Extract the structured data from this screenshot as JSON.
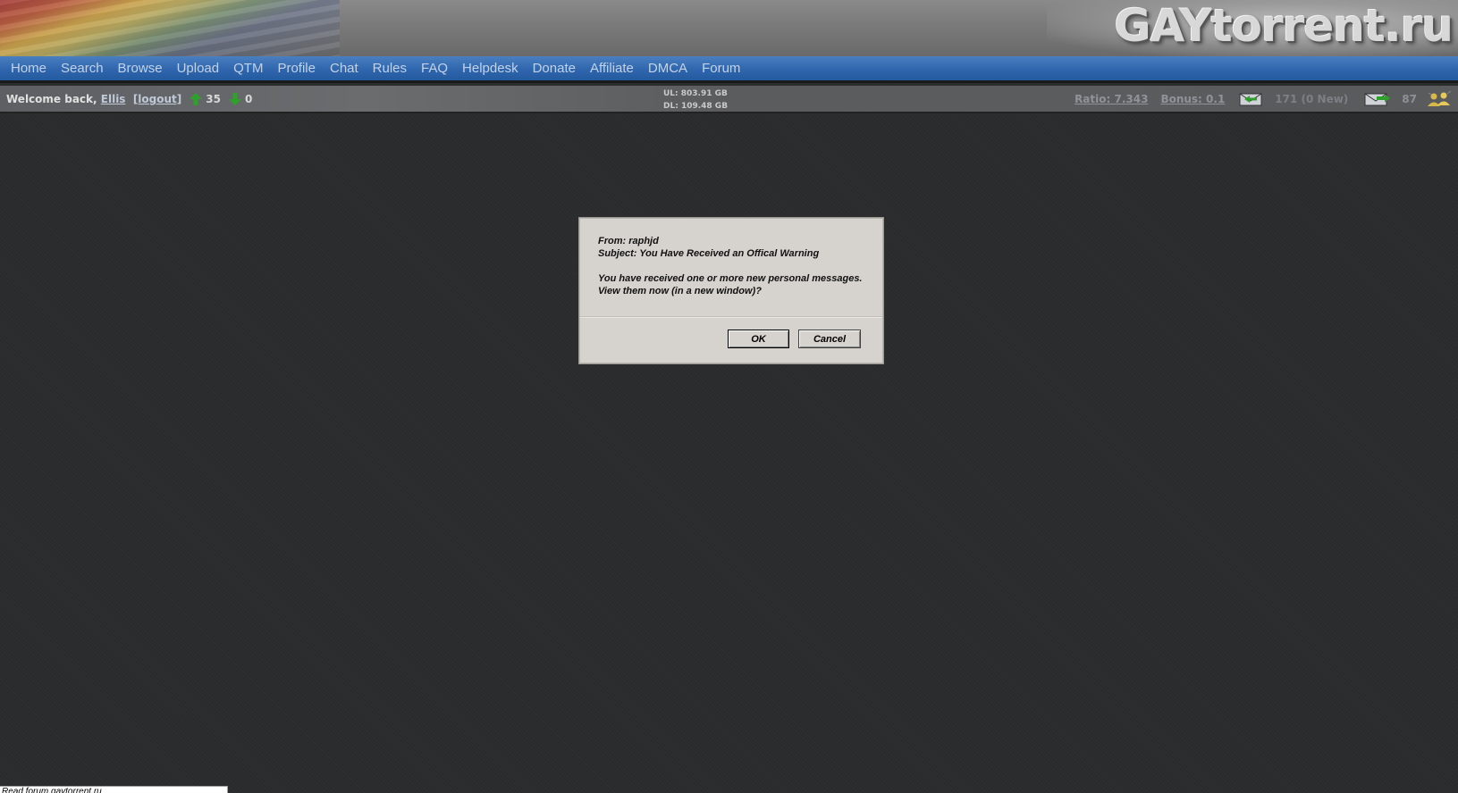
{
  "header": {
    "logo_text": "GAYtorrent.ru"
  },
  "nav": {
    "items": [
      "Home",
      "Search",
      "Browse",
      "Upload",
      "QTM",
      "Profile",
      "Chat",
      "Rules",
      "FAQ",
      "Helpdesk",
      "Donate",
      "Affiliate",
      "DMCA",
      "Forum"
    ]
  },
  "status": {
    "welcome_prefix": "Welcome back,",
    "username": "Ellis",
    "logout_label": "[logout]",
    "seeding_count": "35",
    "leeching_count": "0",
    "uploaded": "UL: 803.91 GB",
    "downloaded": "DL: 109.48 GB",
    "ratio": "Ratio: 7.343",
    "bonus": "Bonus: 0.1",
    "inbox": "171 (0 New)",
    "outbox": "87",
    "up_arrow_icon": "arrow-up-icon",
    "down_arrow_icon": "arrow-down-icon",
    "inbox_icon": "envelope-in-icon",
    "outbox_icon": "envelope-out-icon",
    "users_icon": "users-icon",
    "colors": {
      "arrow_green": "#2ea12a",
      "nav_blue": "#2f66ad"
    }
  },
  "dialog": {
    "from_line": "From: raphjd",
    "subject_line": "Subject: You Have Received an Offical Warning",
    "message_line1": "You have received one or more new personal messages.",
    "message_line2": "View them now (in a new window)?",
    "ok_label": "OK",
    "cancel_label": "Cancel"
  },
  "browser": {
    "status_text": "Read forum.gaytorrent.ru"
  }
}
